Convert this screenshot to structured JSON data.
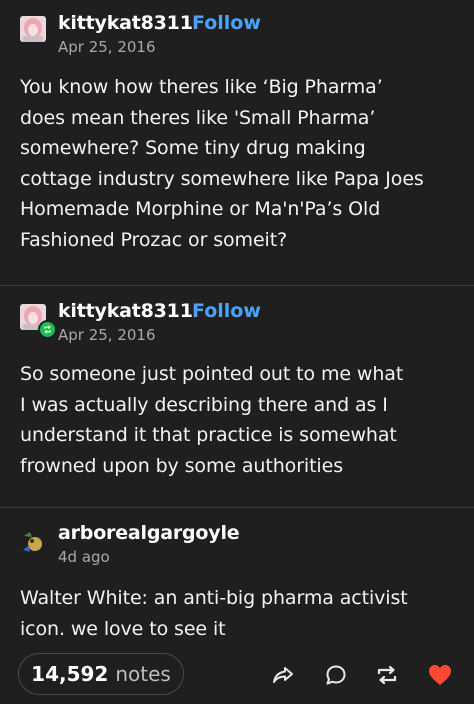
{
  "posts": [
    {
      "username": "kittykat8311",
      "follow_label": "Follow",
      "date": "Apr 25, 2016",
      "lines": [
        "You know how theres like ‘Big Pharma’",
        "does mean theres like 'Small Pharma’",
        "somewhere? Some tiny drug making",
        "cottage industry somewhere like Papa Joes",
        "Homemade Morphine or Ma'n'Pa’s Old",
        "Fashioned Prozac or someit?"
      ]
    },
    {
      "username": "kittykat8311",
      "follow_label": "Follow",
      "date": "Apr 25, 2016",
      "lines": [
        "So someone just pointed out to me what",
        "I was actually describing there and as I",
        "understand it that practice is somewhat",
        "frowned upon by some authorities"
      ]
    },
    {
      "username": "arborealgargoyle",
      "date": "4d ago",
      "lines": [
        "Walter White: an anti-big pharma activist",
        "icon. we love to see it"
      ]
    }
  ],
  "footer": {
    "notes_count": "14,592",
    "notes_label": "notes"
  },
  "icons": {
    "share": "share-icon",
    "reply": "reply-icon",
    "reblog": "reblog-icon",
    "like": "heart-icon"
  },
  "colors": {
    "background": "#1f1f1f",
    "follow": "#4aa3ff",
    "reblog_badge": "#18c24e",
    "like": "#ff4930"
  }
}
